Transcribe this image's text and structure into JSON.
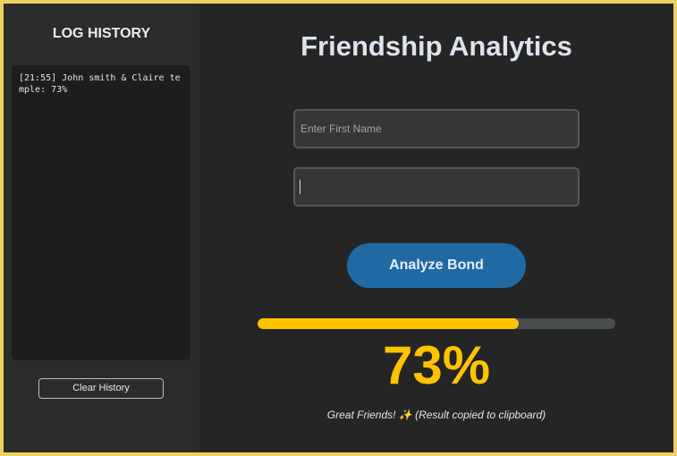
{
  "sidebar": {
    "title": "LOG HISTORY",
    "log_entries": [
      "[21:55] John smith & Claire temple: 73%"
    ],
    "clear_button_label": "Clear History"
  },
  "main": {
    "title": "Friendship Analytics",
    "first_name_input": {
      "placeholder": "Enter First Name",
      "value": ""
    },
    "second_name_input": {
      "placeholder": "",
      "value": ""
    },
    "analyze_button_label": "Analyze Bond",
    "progress": 0.73,
    "percent_text": "73%",
    "status_text": "Great Friends! ✨ (Result copied to clipboard)"
  },
  "colors": {
    "accent": "#1f6aa5",
    "progress_fill": "#ffc400",
    "frame": "#f0d060"
  }
}
